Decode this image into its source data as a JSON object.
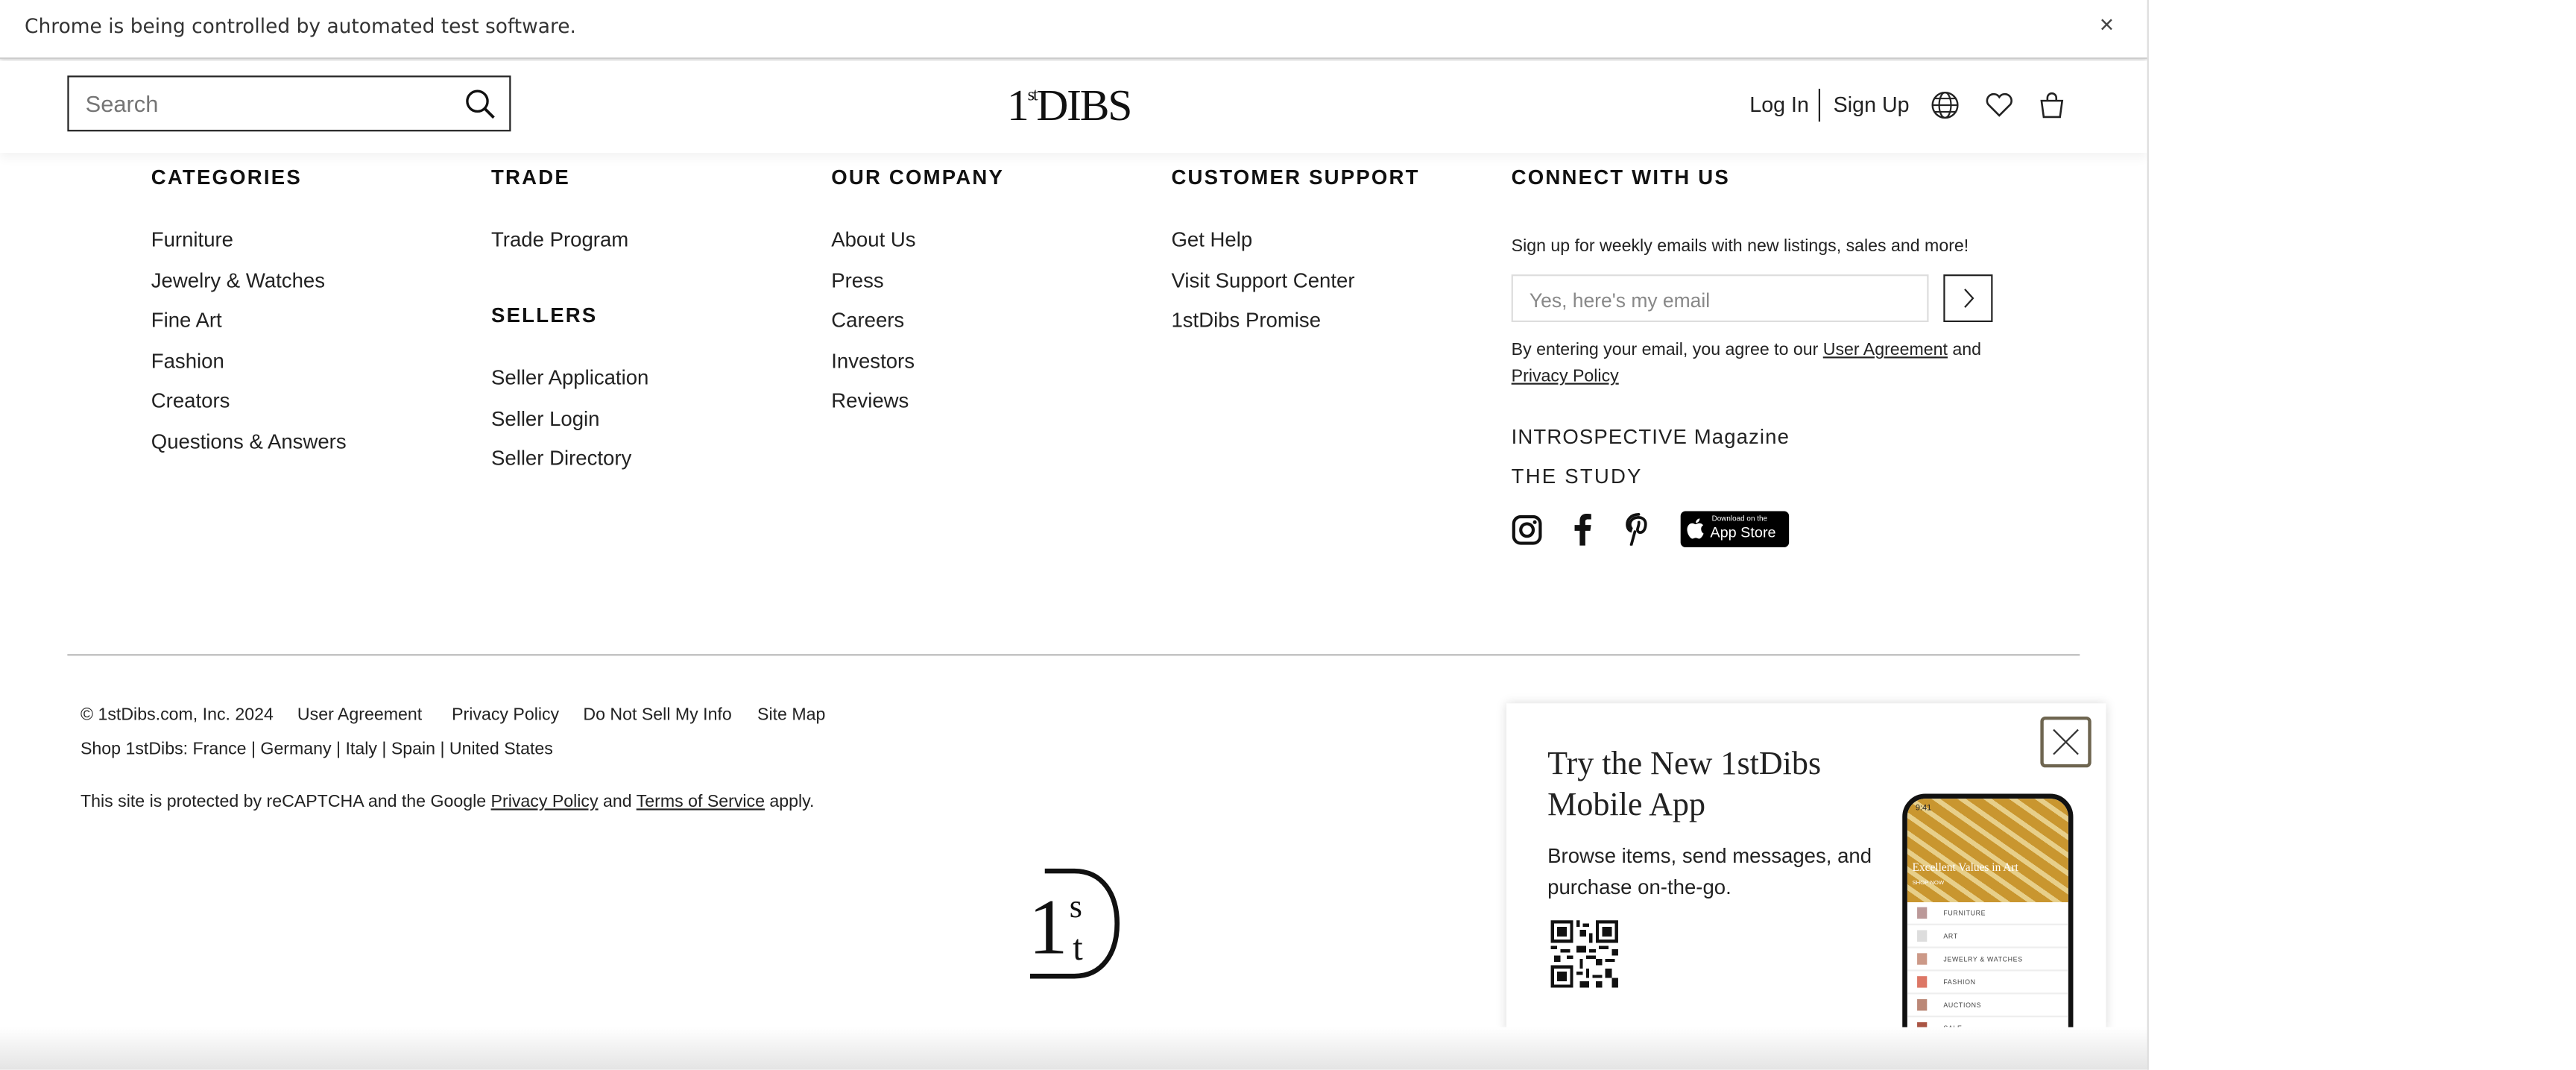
{
  "browser": {
    "infobar_message": "Chrome is being controlled by automated test software.",
    "close_label": "×"
  },
  "header": {
    "search_placeholder": "Search",
    "logo": "1stDIBS",
    "logo_parts": {
      "one": "1",
      "st": "st",
      "dibs": "DIBS"
    },
    "login": "Log In",
    "signup": "Sign Up"
  },
  "footer": {
    "categories": {
      "title": "CATEGORIES",
      "items": [
        "Furniture",
        "Jewelry & Watches",
        "Fine Art",
        "Fashion",
        "Creators",
        "Questions & Answers"
      ]
    },
    "trade": {
      "title": "TRADE",
      "items": [
        "Trade Program"
      ]
    },
    "sellers": {
      "title": "SELLERS",
      "items": [
        "Seller Application",
        "Seller Login",
        "Seller Directory"
      ]
    },
    "company": {
      "title": "OUR COMPANY",
      "items": [
        "About Us",
        "Press",
        "Careers",
        "Investors",
        "Reviews"
      ]
    },
    "support": {
      "title": "CUSTOMER SUPPORT",
      "items": [
        "Get Help",
        "Visit Support Center",
        "1stDibs Promise"
      ]
    },
    "connect": {
      "title": "CONNECT WITH US",
      "signup_text": "Sign up for weekly emails with new listings, sales and more!",
      "email_placeholder": "Yes, here's my email",
      "consent_prefix": "By entering your email, you agree to our ",
      "user_agreement": "User Agreement",
      "and": " and",
      "privacy_policy": "Privacy Policy",
      "introspective": "INTROSPECTIVE Magazine",
      "the_study": "THE STUDY",
      "social_icons": [
        "instagram-icon",
        "facebook-icon",
        "pinterest-icon"
      ],
      "appstore_small": "Download on the",
      "appstore_big": "App Store"
    },
    "legal": {
      "copyright": "© 1stDibs.com, Inc. 2024",
      "links": [
        "User Agreement",
        "Privacy Policy",
        "Do Not Sell My Info",
        "Site Map"
      ],
      "shop_label": "Shop 1stDibs:",
      "countries": [
        "France",
        "Germany",
        "Italy",
        "Spain",
        "United States"
      ],
      "recaptcha_prefix": "This site is protected by reCAPTCHA and the Google ",
      "recaptcha_privacy": "Privacy Policy",
      "recaptcha_and": " and ",
      "recaptcha_terms": "Terms of Service",
      "recaptcha_suffix": " apply."
    }
  },
  "app_popup": {
    "title": "Try the New 1stDibs Mobile App",
    "description": "Browse items, send messages, and purchase on-the-go.",
    "phone": {
      "time": "9:41",
      "hero_text": "Excellent Values in Art",
      "hero_cta": "SHOP NOW",
      "menu": [
        "FURNITURE",
        "ART",
        "JEWELRY & WATCHES",
        "FASHION",
        "AUCTIONS",
        "SALE"
      ]
    }
  },
  "colors": {
    "text": "#222222",
    "popup_close_border": "#6e6550"
  }
}
